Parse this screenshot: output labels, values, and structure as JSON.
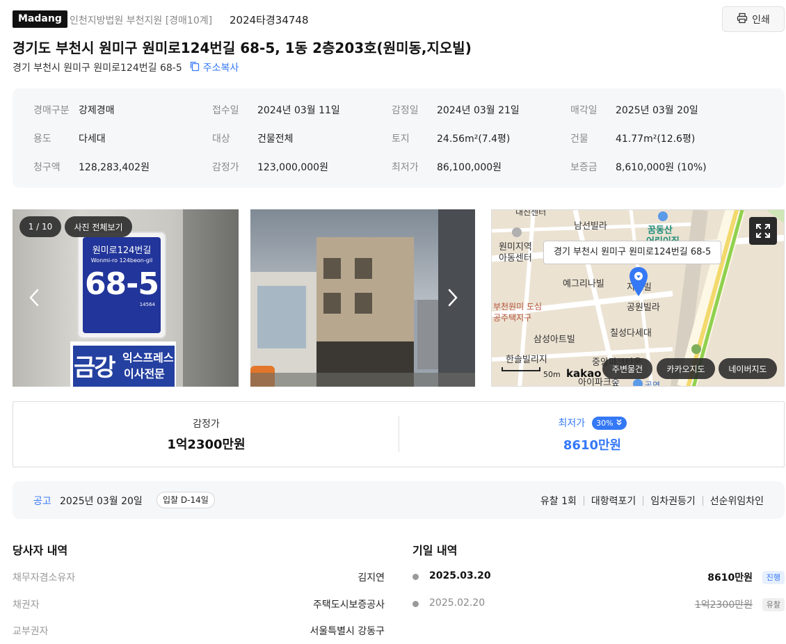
{
  "header": {
    "logo": "Madang",
    "court": "인천지방법원 부천지원 [경매10계]",
    "case_no": "2024타경34748",
    "print_label": "인쇄"
  },
  "title": "경기도 부천시 원미구 원미로124번길 68-5, 1동 2층203호(원미동,지오빌)",
  "sub_address": {
    "text": "경기 부천시 원미구 원미로124번길 68-5",
    "copy_label": "주소복사"
  },
  "info": [
    {
      "k": "경매구분",
      "v": "강제경매"
    },
    {
      "k": "접수일",
      "v": "2024년 03월 11일"
    },
    {
      "k": "감정일",
      "v": "2024년 03월 21일"
    },
    {
      "k": "매각일",
      "v": "2025년 03월 20일"
    },
    {
      "k": "용도",
      "v": "다세대"
    },
    {
      "k": "대상",
      "v": "건물전체"
    },
    {
      "k": "토지",
      "v": "24.56m²(7.4평)"
    },
    {
      "k": "건물",
      "v": "41.77m²(12.6평)"
    },
    {
      "k": "청구액",
      "v": "128,283,402원"
    },
    {
      "k": "감정가",
      "v": "123,000,000원"
    },
    {
      "k": "최저가",
      "v": "86,100,000원"
    },
    {
      "k": "보증금",
      "v": "8,610,000원 (10%)"
    }
  ],
  "gallery": {
    "counter": "1 / 10",
    "view_all": "사진 전체보기",
    "sign_line1": "원미로124번길",
    "sign_line2": "Wonmi-ro 124beon-gil",
    "sign_number": "68-5",
    "sign_small": "14564",
    "banner1": "금강",
    "banner2": "익스프레스",
    "banner3": "이사전문"
  },
  "map": {
    "tooltip": "경기 부천시 원미구 원미로124번길 68-5",
    "labels": [
      "내진센터",
      "남선빌라",
      "꿈동산",
      "어린이집",
      "원미지역",
      "아동센터",
      "예그리나빌",
      "지오빌",
      "공원빌라",
      "부천원미 도심",
      "공주택지구",
      "칠성다세대",
      "삼성아트빌",
      "한솔빌리지",
      "중앙파크타운",
      "아이파크숲",
      "공연"
    ],
    "scale": "50m",
    "brand": "kakao",
    "btn_nearby": "주변물건",
    "btn_kakao": "카카오지도",
    "btn_naver": "네이버지도"
  },
  "price": {
    "appraised_label": "감정가",
    "appraised_value": "1억2300만원",
    "min_label": "최저가",
    "min_pct": "30%",
    "min_value": "8610만원"
  },
  "notice": {
    "label": "공고",
    "date": "2025년 03월 20일",
    "badge": "입찰 D-14일",
    "tags": [
      "유찰 1회",
      "대항력포기",
      "임차권등기",
      "선순위임차인"
    ]
  },
  "parties": {
    "title": "당사자 내역",
    "rows": [
      {
        "k": "채무자겸소유자",
        "v": "김지연"
      },
      {
        "k": "채권자",
        "v": "주택도시보증공사"
      },
      {
        "k": "교부권자",
        "v": "서울특별시 강동구"
      }
    ]
  },
  "schedule": {
    "title": "기일 내역",
    "rows": [
      {
        "date": "2025.03.20",
        "price": "8610만원",
        "status": "진행"
      },
      {
        "date": "2025.02.20",
        "price": "1억2300만원",
        "status": "유찰"
      }
    ]
  },
  "colors": {
    "accent": "#3478f6",
    "panel": "#f6f7f9",
    "route": "#8fd14f"
  }
}
